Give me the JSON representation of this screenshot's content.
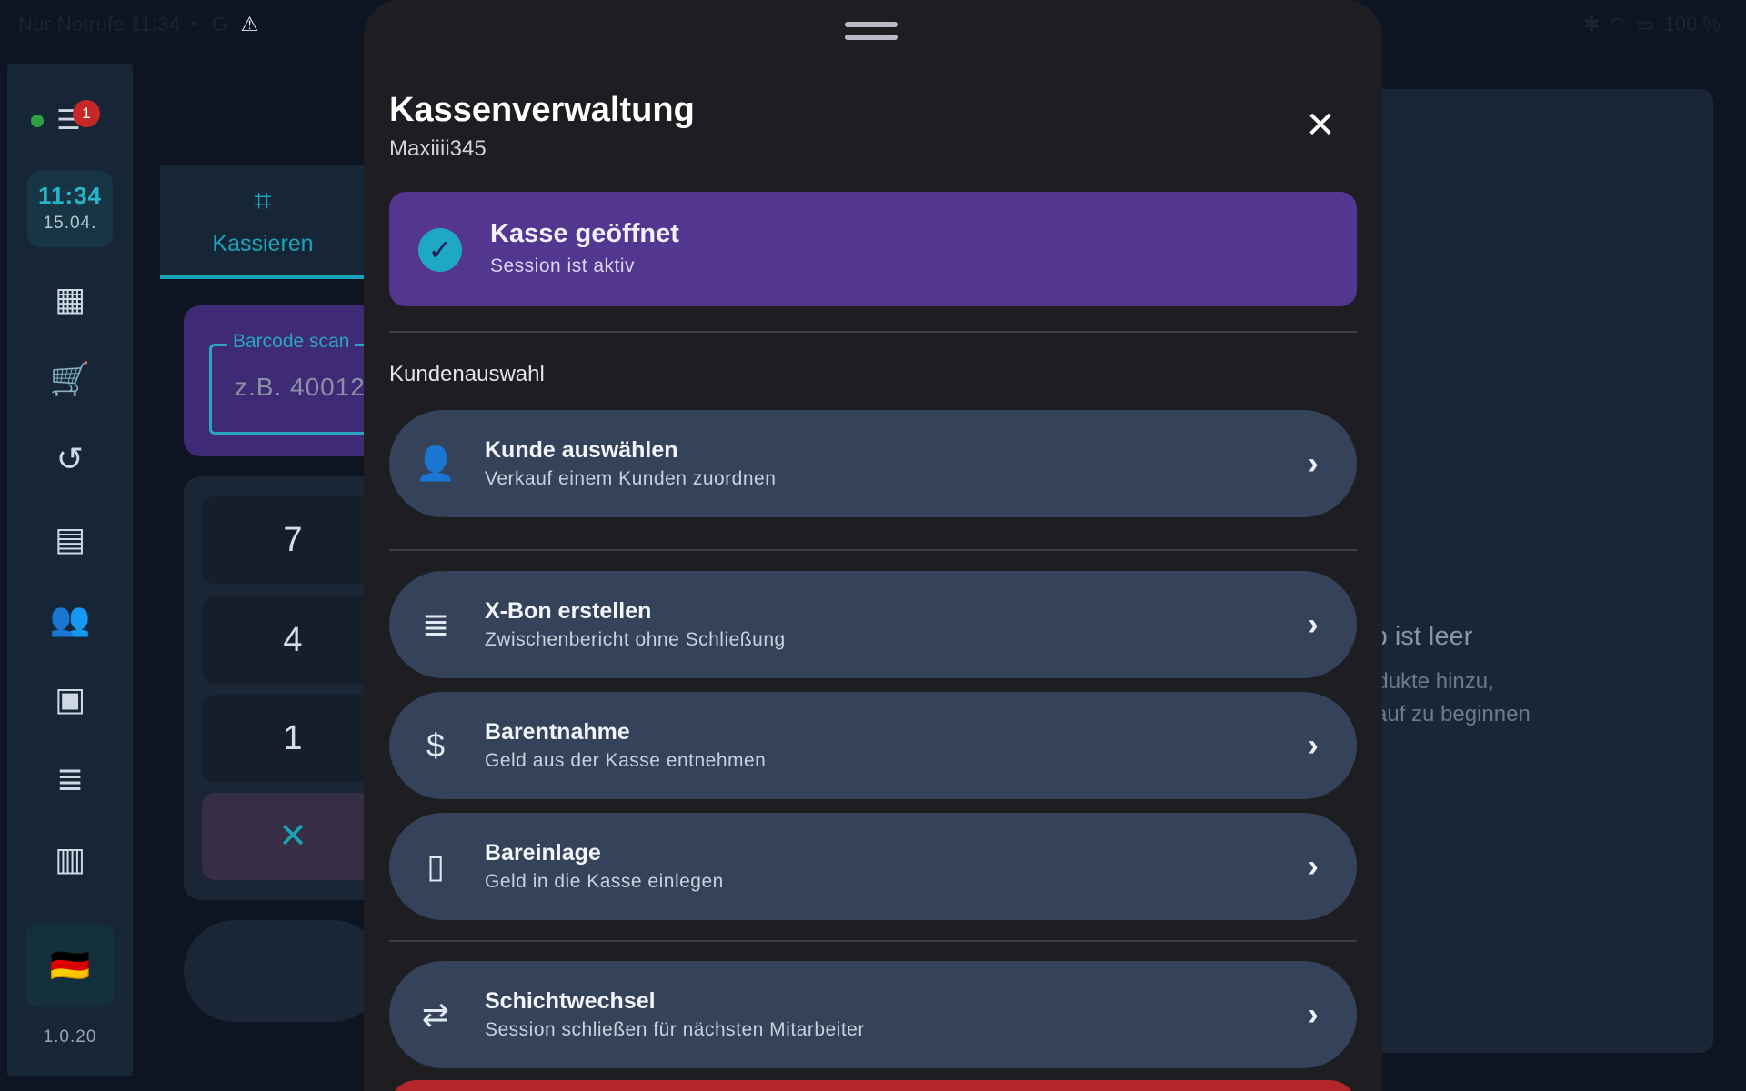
{
  "status_bar": {
    "left_text": "Nur Notrufe 11:34",
    "left_icons": [
      "alarm-icon",
      "g-icon",
      "warning-icon"
    ],
    "battery": "100 %"
  },
  "rail": {
    "notification_count": "1",
    "clock_time": "11:34",
    "clock_date": "15.04.",
    "flag": "🇩🇪",
    "version": "1.0.20",
    "items": [
      "dashboard-icon",
      "cart-icon",
      "history-icon",
      "archive-icon",
      "customers-icon",
      "calendar-icon",
      "receipt-icon",
      "reports-icon"
    ]
  },
  "checkout": {
    "tab_label": "Kassieren",
    "barcode_label": "Barcode scan",
    "barcode_placeholder": "z.B. 40012",
    "keys": [
      "7",
      "4",
      "1"
    ],
    "clear_key": "✕"
  },
  "cart": {
    "empty_title": "rb ist leer",
    "hint_line1": "odukte hinzu,",
    "hint_line2": "kauf zu beginnen"
  },
  "sheet": {
    "title": "Kassenverwaltung",
    "subtitle": "Maxiiii345",
    "status_title": "Kasse geöffnet",
    "status_sub": "Session ist aktiv",
    "section_label": "Kundenauswahl",
    "rows": [
      {
        "title": "Kunde auswählen",
        "sub": "Verkauf einem Kunden zuordnen",
        "icon": "add-person-icon"
      },
      {
        "title": "X-Bon erstellen",
        "sub": "Zwischenbericht ohne Schließung",
        "icon": "receipt-icon"
      },
      {
        "title": "Barentnahme",
        "sub": "Geld aus der Kasse entnehmen",
        "icon": "money-off-icon"
      },
      {
        "title": "Bareinlage",
        "sub": "Geld in die Kasse einlegen",
        "icon": "cash-100-icon"
      },
      {
        "title": "Schichtwechsel",
        "sub": "Session schließen für nächsten Mitarbeiter",
        "icon": "swap-icon"
      }
    ]
  },
  "colors": {
    "accent_teal": "#1aa3b8",
    "status_purple": "#52368f",
    "row_bg": "#34435a",
    "danger_red": "#b3262b"
  }
}
